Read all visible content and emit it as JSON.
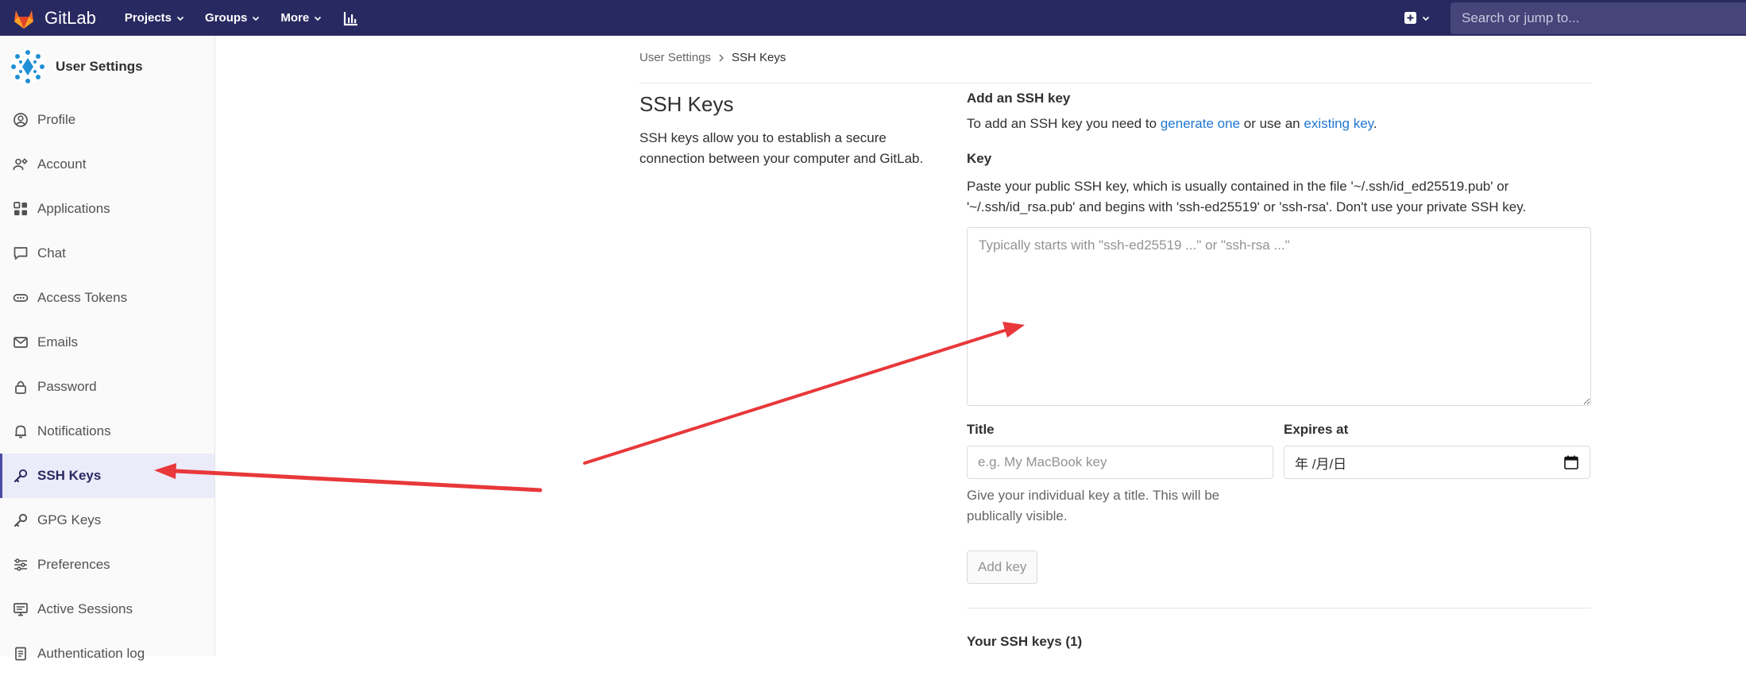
{
  "navbar": {
    "brand": "GitLab",
    "menu": [
      {
        "label": "Projects",
        "name": "nav-projects"
      },
      {
        "label": "Groups",
        "name": "nav-groups"
      },
      {
        "label": "More",
        "name": "nav-more"
      }
    ],
    "search_placeholder": "Search or jump to...",
    "colors": {
      "bg": "#292961",
      "search_bg": "#45457a"
    }
  },
  "sidebar": {
    "title": "User Settings",
    "active": "SSH Keys",
    "items": [
      {
        "label": "Profile",
        "icon": "profile-icon"
      },
      {
        "label": "Account",
        "icon": "account-icon"
      },
      {
        "label": "Applications",
        "icon": "applications-icon"
      },
      {
        "label": "Chat",
        "icon": "chat-icon"
      },
      {
        "label": "Access Tokens",
        "icon": "token-icon"
      },
      {
        "label": "Emails",
        "icon": "mail-icon"
      },
      {
        "label": "Password",
        "icon": "lock-icon"
      },
      {
        "label": "Notifications",
        "icon": "bell-icon"
      },
      {
        "label": "SSH Keys",
        "icon": "key-icon"
      },
      {
        "label": "GPG Keys",
        "icon": "key-icon"
      },
      {
        "label": "Preferences",
        "icon": "preferences-icon"
      },
      {
        "label": "Active Sessions",
        "icon": "monitor-icon"
      },
      {
        "label": "Authentication log",
        "icon": "log-icon"
      }
    ]
  },
  "breadcrumb": {
    "parent": "User Settings",
    "current": "SSH Keys"
  },
  "section": {
    "title": "SSH Keys",
    "description": "SSH keys allow you to establish a secure connection between your computer and GitLab."
  },
  "form": {
    "heading": "Add an SSH key",
    "intro_prefix": "To add an SSH key you need to ",
    "intro_link1": "generate one",
    "intro_middle": " or use an ",
    "intro_link2": "existing key",
    "intro_suffix": ".",
    "key_label": "Key",
    "key_hint": "Paste your public SSH key, which is usually contained in the file '~/.ssh/id_ed25519.pub' or '~/.ssh/id_rsa.pub' and begins with 'ssh-ed25519' or 'ssh-rsa'. Don't use your private SSH key.",
    "key_placeholder": "Typically starts with \"ssh-ed25519 ...\" or \"ssh-rsa ...\"",
    "title_label": "Title",
    "title_placeholder": "e.g. My MacBook key",
    "title_help": "Give your individual key a title. This will be publically visible.",
    "expires_label": "Expires at",
    "expires_value": "年 /月/日",
    "submit_label": "Add key",
    "your_keys": "Your SSH keys (1)"
  },
  "annotation_color": "#e8383a"
}
